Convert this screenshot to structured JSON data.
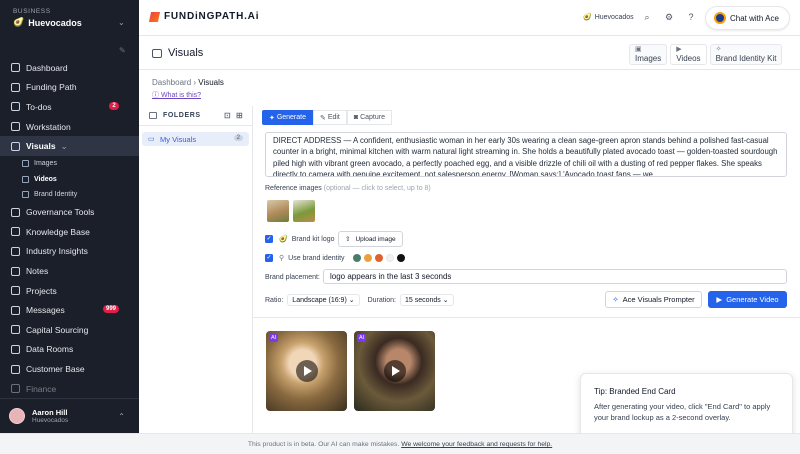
{
  "sidebar": {
    "business_label": "BUSINESS",
    "business_name": "Huevocados",
    "items": [
      {
        "label": "Dashboard"
      },
      {
        "label": "Funding Path"
      },
      {
        "label": "To-dos",
        "badge": "2"
      },
      {
        "label": "Workstation"
      },
      {
        "label": "Visuals"
      },
      {
        "label": "Governance Tools"
      },
      {
        "label": "Knowledge Base"
      },
      {
        "label": "Industry Insights"
      },
      {
        "label": "Notes"
      },
      {
        "label": "Projects"
      },
      {
        "label": "Messages",
        "badge": "999"
      },
      {
        "label": "Capital Sourcing"
      },
      {
        "label": "Data Rooms"
      },
      {
        "label": "Customer Base"
      },
      {
        "label": "Finance"
      }
    ],
    "sub_items": [
      {
        "label": "Images"
      },
      {
        "label": "Videos"
      },
      {
        "label": "Brand Identity"
      }
    ],
    "user": {
      "name": "Aaron Hill",
      "org": "Huevocados"
    }
  },
  "topbar": {
    "logo": "FUNDiNGPATH.Ai",
    "business": "Huevocados",
    "chat_label": "Chat with Ace"
  },
  "page": {
    "title": "Visuals",
    "tabs": [
      {
        "label": "Images"
      },
      {
        "label": "Videos"
      },
      {
        "label": "Brand Identity Kit"
      }
    ],
    "breadcrumb_root": "Dashboard",
    "breadcrumb_current": "Visuals",
    "what_is_this": "What is this?"
  },
  "folders": {
    "header": "FOLDERS",
    "items": [
      {
        "label": "My Visuals",
        "count": "2"
      }
    ]
  },
  "editor": {
    "tabs": [
      "Generate",
      "Edit",
      "Capture"
    ],
    "prompt": "DIRECT ADDRESS — A confident, enthusiastic woman in her early 30s wearing a clean sage-green apron stands behind a polished fast-casual counter in a bright, minimal kitchen with warm natural light streaming in. She holds a beautifully plated avocado toast — golden-toasted sourdough piled high with vibrant green avocado, a perfectly poached egg, and a visible drizzle of chili oil with a dusting of red pepper flakes. She speaks directly to camera with genuine excitement, not salesperson energy. [Woman says:] 'Avocado toast fans — we",
    "reference_label": "Reference images",
    "reference_hint": "(optional — click to select, up to 8)",
    "brand_logo_label": "Brand kit logo",
    "upload_label": "Upload image",
    "brand_identity_label": "Use brand identity",
    "brand_colors": [
      "#4a7c6a",
      "#e9a23b",
      "#e0612e",
      "#f1f1f1",
      "#111111"
    ],
    "placement_label": "Brand placement:",
    "placement_value": "logo appears in the last 3 seconds",
    "ratio_label": "Ratio:",
    "ratio_value": "Landscape (16:9)",
    "duration_label": "Duration:",
    "duration_value": "15 seconds",
    "prompter_label": "Ace Visuals Prompter",
    "generate_label": "Generate Video"
  },
  "videos": [
    {
      "badge": "AI"
    },
    {
      "badge": "AI"
    }
  ],
  "tip": {
    "title": "Tip: Branded End Card",
    "body": "After generating your video, click \"End Card\" to apply your brand lockup as a 2-second overlay."
  },
  "footer": {
    "text": "This product is in beta. Our AI can make mistakes.",
    "link": "We welcome your feedback and requests for help."
  }
}
